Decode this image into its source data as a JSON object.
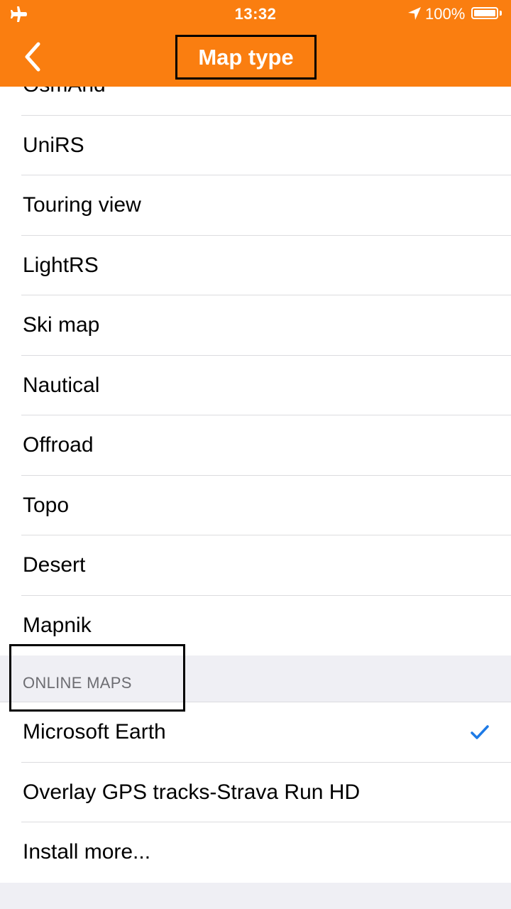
{
  "status": {
    "time": "13:32",
    "battery": "100%"
  },
  "nav": {
    "title": "Map type"
  },
  "list": {
    "offline_items": [
      "OsmAnd",
      "UniRS",
      "Touring view",
      "LightRS",
      "Ski map",
      "Nautical",
      "Offroad",
      "Topo",
      "Desert",
      "Mapnik"
    ],
    "online_section_title": "ONLINE MAPS",
    "online_items": [
      "Microsoft Earth",
      "Overlay GPS tracks-Strava Run HD",
      "Install more..."
    ],
    "selected": "Microsoft Earth"
  },
  "colors": {
    "accent": "#fa7e10",
    "check": "#1d7ae6",
    "background": "#efeff4"
  },
  "icons": [
    "airplane-icon",
    "location-arrow-icon",
    "battery-icon",
    "back-chevron-icon",
    "checkmark-icon"
  ]
}
